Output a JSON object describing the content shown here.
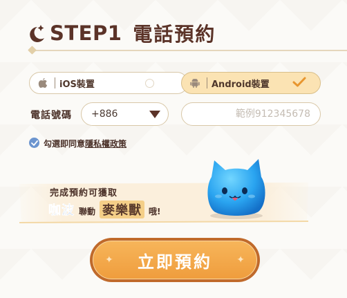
{
  "header": {
    "step": "STEP1",
    "title": "電話預約"
  },
  "devices": {
    "ios": {
      "label": "iOS裝置",
      "icon": "apple-icon",
      "selected": false
    },
    "android": {
      "label": "Android裝置",
      "icon": "android-icon",
      "selected": true
    }
  },
  "phone": {
    "label": "電話號碼",
    "country_code": "+886",
    "placeholder": "範例912345678",
    "value": ""
  },
  "agreement": {
    "prefix": "勾選即同意",
    "link": "隱私權政策",
    "checked": true
  },
  "reward": {
    "line1": "完成預約可獲取",
    "kapo": "咖波",
    "connector": "聯動",
    "item": "麥樂獸",
    "suffix": "哦!"
  },
  "cta": {
    "label": "立即預約"
  },
  "colors": {
    "accent": "#5b3328",
    "button": "#f0a040",
    "android_bg": "#fbe3b3",
    "check_blue": "#6c95cf"
  }
}
